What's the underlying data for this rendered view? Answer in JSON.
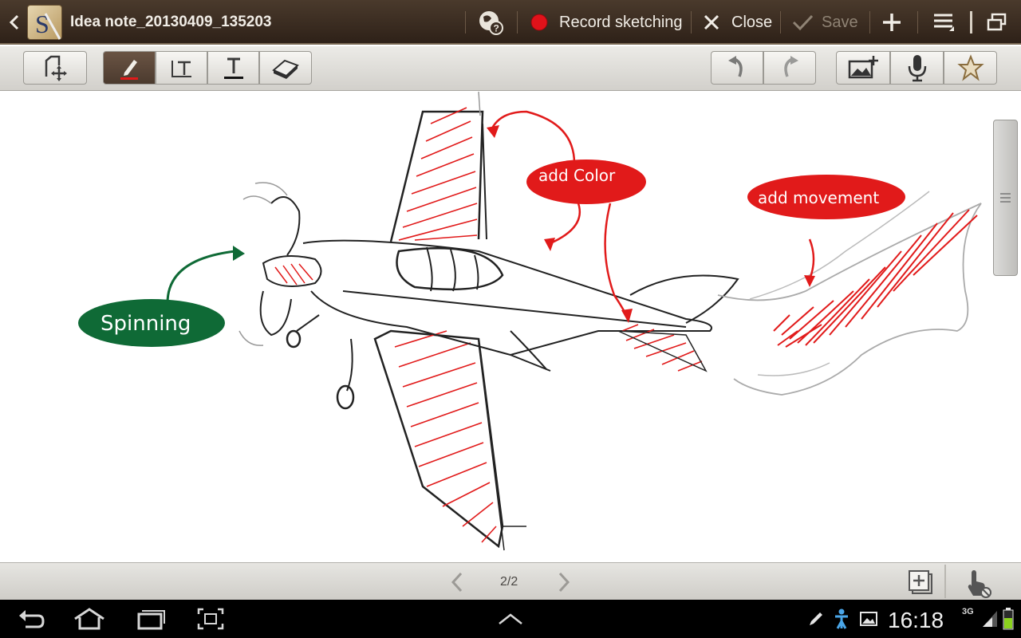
{
  "titlebar": {
    "title": "Idea note_20130409_135203",
    "record_label": "Record sketching",
    "close_label": "Close",
    "save_label": "Save"
  },
  "toolbar": {
    "tools": [
      "select-tool",
      "pen-tool",
      "text-box-tool",
      "text-tool",
      "eraser-tool"
    ],
    "active_tool": "pen-tool",
    "pen_color": "#e11a1a"
  },
  "sketch": {
    "annotations": [
      {
        "text": "Spinning",
        "color": "#0f6a36"
      },
      {
        "text": "add Color",
        "color": "#e11a1a"
      },
      {
        "text": "add movement",
        "color": "#e11a1a"
      }
    ]
  },
  "pager": {
    "current": 2,
    "total": 2,
    "label": "2/2"
  },
  "statusbar": {
    "time": "16:18",
    "network": "3G"
  },
  "colors": {
    "titlebar_bg": "#3b2d22",
    "accent_red": "#e11a1a",
    "accent_green": "#0f6a36"
  }
}
